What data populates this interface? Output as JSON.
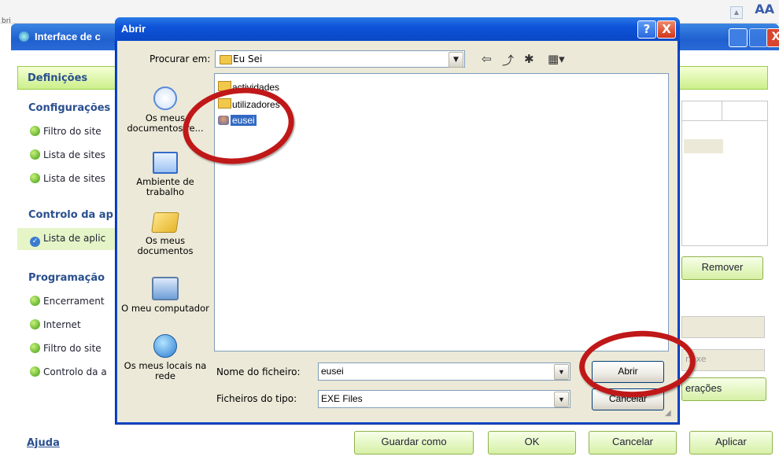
{
  "top_strip": {
    "partial_label": "bri",
    "aa": "AA"
  },
  "bg_window": {
    "title": "Interface de c",
    "section_title": "Definições",
    "group_config": "Configurações",
    "config_items": [
      "Filtro do site",
      "Lista de sites",
      "Lista de sites"
    ],
    "group_control": "Controlo da ap",
    "control_items": [
      "Lista de aplic"
    ],
    "group_prog": "Programação",
    "prog_items": [
      "Encerrament",
      "Internet",
      "Filtro do site",
      "Controlo da a"
    ],
    "remover": "Remover",
    "exe_field": "r.exe",
    "alteracoes": "erações",
    "ajuda": "Ajuda",
    "buttons": {
      "guardar": "Guardar como",
      "ok": "OK",
      "cancelar": "Cancelar",
      "aplicar": "Aplicar"
    }
  },
  "dialog": {
    "title": "Abrir",
    "help_glyph": "?",
    "close_glyph": "X",
    "look_in_label": "Procurar em:",
    "look_in_value": "Eu Sei",
    "places": [
      {
        "label": "Os meus documentos re...",
        "icon": "recent-documents-icon"
      },
      {
        "label": "Ambiente de trabalho",
        "icon": "desktop-icon"
      },
      {
        "label": "Os meus documentos",
        "icon": "my-documents-icon"
      },
      {
        "label": "O meu computador",
        "icon": "my-computer-icon"
      },
      {
        "label": "Os meus locais na rede",
        "icon": "network-places-icon"
      }
    ],
    "files": [
      {
        "name": "actividades",
        "icon": "folder-icon"
      },
      {
        "name": "utilizadores",
        "icon": "folder-icon"
      },
      {
        "name": "eusei",
        "icon": "user-app-icon",
        "selected": true
      }
    ],
    "file_name_label": "Nome do ficheiro:",
    "file_name_value": "eusei",
    "file_type_label": "Ficheiros do tipo:",
    "file_type_value": "EXE Files",
    "open_button": "Abrir",
    "cancel_button": "Cancelar"
  },
  "annotation_color": "#c01818"
}
